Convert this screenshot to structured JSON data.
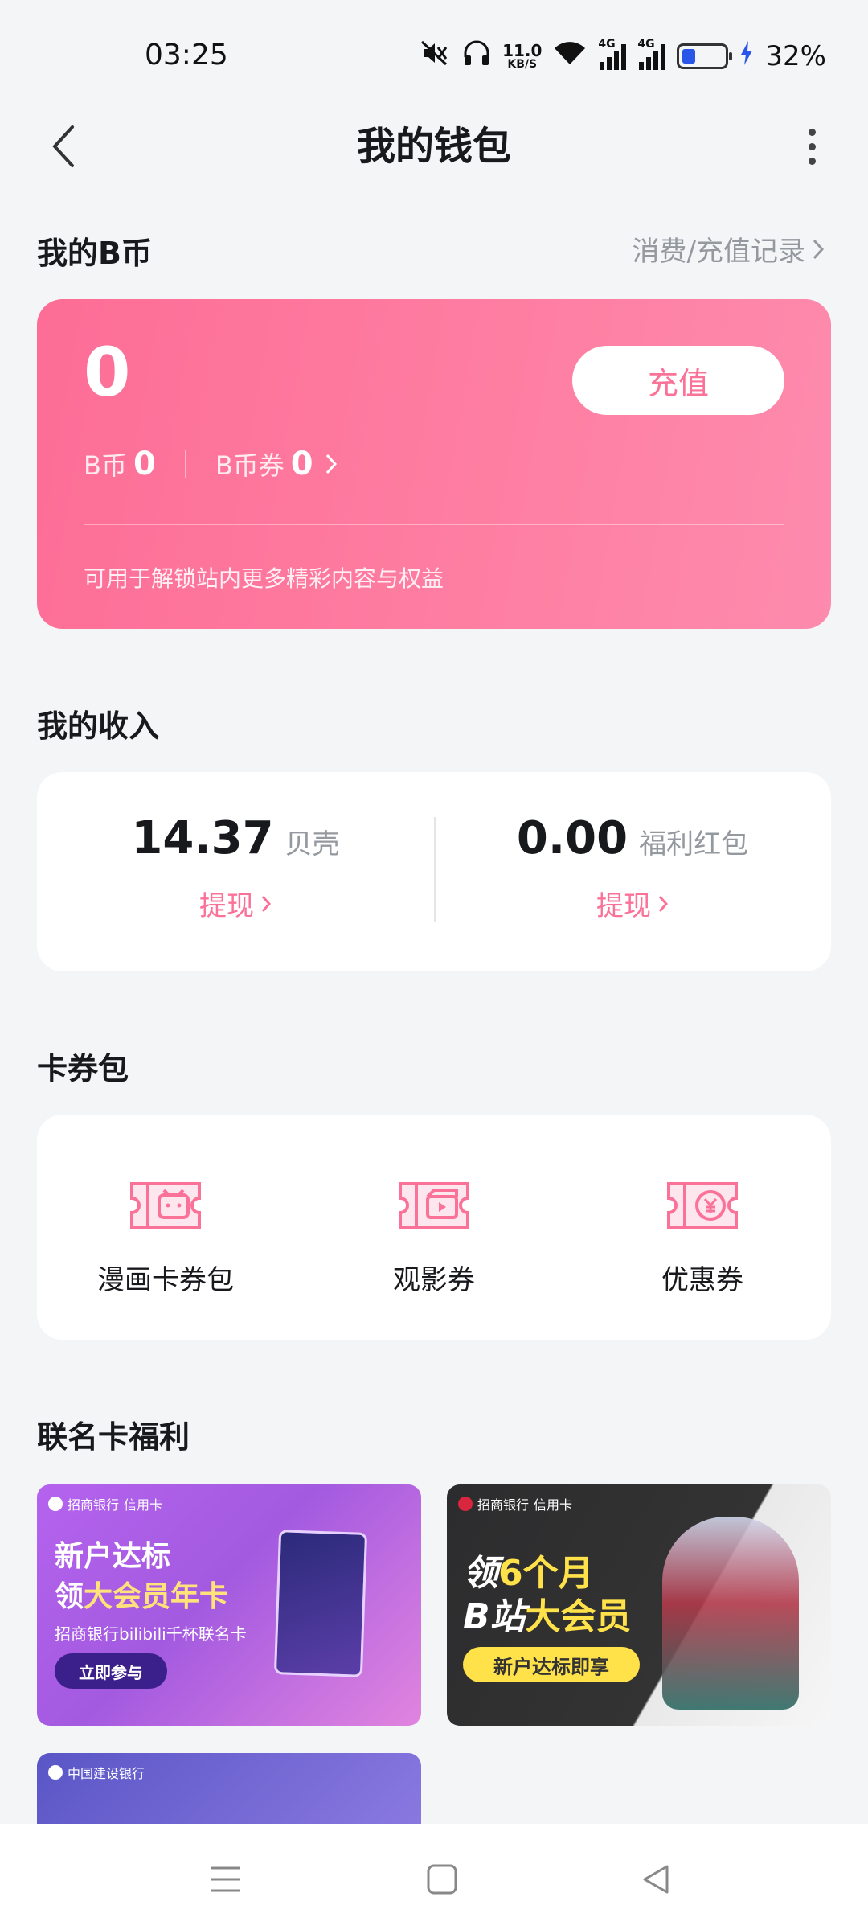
{
  "status_bar": {
    "time": "03:25",
    "speed_value": "11.0",
    "speed_unit": "KB/S",
    "net1": "4G",
    "net2": "4G",
    "battery": "32%"
  },
  "nav": {
    "title": "我的钱包"
  },
  "bcoin": {
    "section_title": "我的B币",
    "records_link": "消费/充值记录",
    "balance": "0",
    "recharge_label": "充值",
    "bcoin_label": "B币",
    "bcoin_value": "0",
    "voucher_label": "B币券",
    "voucher_value": "0",
    "note": "可用于解锁站内更多精彩内容与权益"
  },
  "income": {
    "section_title": "我的收入",
    "left": {
      "value": "14.37",
      "unit": "贝壳",
      "action": "提现"
    },
    "right": {
      "value": "0.00",
      "unit": "福利红包",
      "action": "提现"
    }
  },
  "coupons": {
    "section_title": "卡券包",
    "items": [
      {
        "label": "漫画卡券包",
        "icon": "comic-ticket-icon"
      },
      {
        "label": "观影券",
        "icon": "movie-ticket-icon"
      },
      {
        "label": "优惠券",
        "icon": "yen-ticket-icon"
      }
    ]
  },
  "cobrand": {
    "section_title": "联名卡福利",
    "banner1": {
      "bank": "招商银行",
      "tag": "信用卡",
      "line1": "新户达标",
      "line2_pre": "领",
      "line2_hl": "大会员年卡",
      "line3": "招商银行bilibili千杯联名卡",
      "cta": "立即参与"
    },
    "banner2": {
      "bank": "招商银行",
      "tag": "信用卡",
      "line1_pre": "领",
      "line1_hl": "6个月",
      "line2_pre": "B站",
      "line2_hl": "大会员",
      "cta": "新户达标即享"
    },
    "banner3": {
      "bank": "中国建设银行"
    }
  },
  "colors": {
    "accent": "#fb7299",
    "card_start": "#fd6d96",
    "card_end": "#fd8bad"
  }
}
